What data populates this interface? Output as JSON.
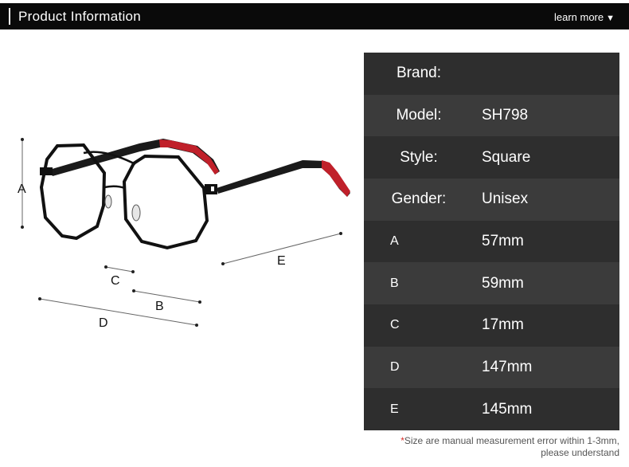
{
  "header": {
    "title": "Product Information",
    "learn_more": "learn more",
    "arrow": "▼"
  },
  "diagram": {
    "label_a": "A",
    "label_b": "B",
    "label_c": "C",
    "label_d": "D",
    "label_e": "E"
  },
  "specs": [
    {
      "label": "Brand:",
      "value": ""
    },
    {
      "label": "Model:",
      "value": "SH798"
    },
    {
      "label": "Style:",
      "value": "Square"
    },
    {
      "label": "Gender:",
      "value": "Unisex"
    },
    {
      "label": "A",
      "value": "57mm"
    },
    {
      "label": "B",
      "value": "59mm"
    },
    {
      "label": "C",
      "value": "17mm"
    },
    {
      "label": "D",
      "value": "147mm"
    },
    {
      "label": "E",
      "value": "145mm"
    }
  ],
  "footnote": {
    "star": "*",
    "line1": "Size are manual measurement error within 1-3mm,",
    "line2": "please understand"
  },
  "colors": {
    "frame": "#111111",
    "temple_accent": "#c0202a",
    "row_dark": "#2e2e2e",
    "row_light": "#3b3b3b"
  }
}
